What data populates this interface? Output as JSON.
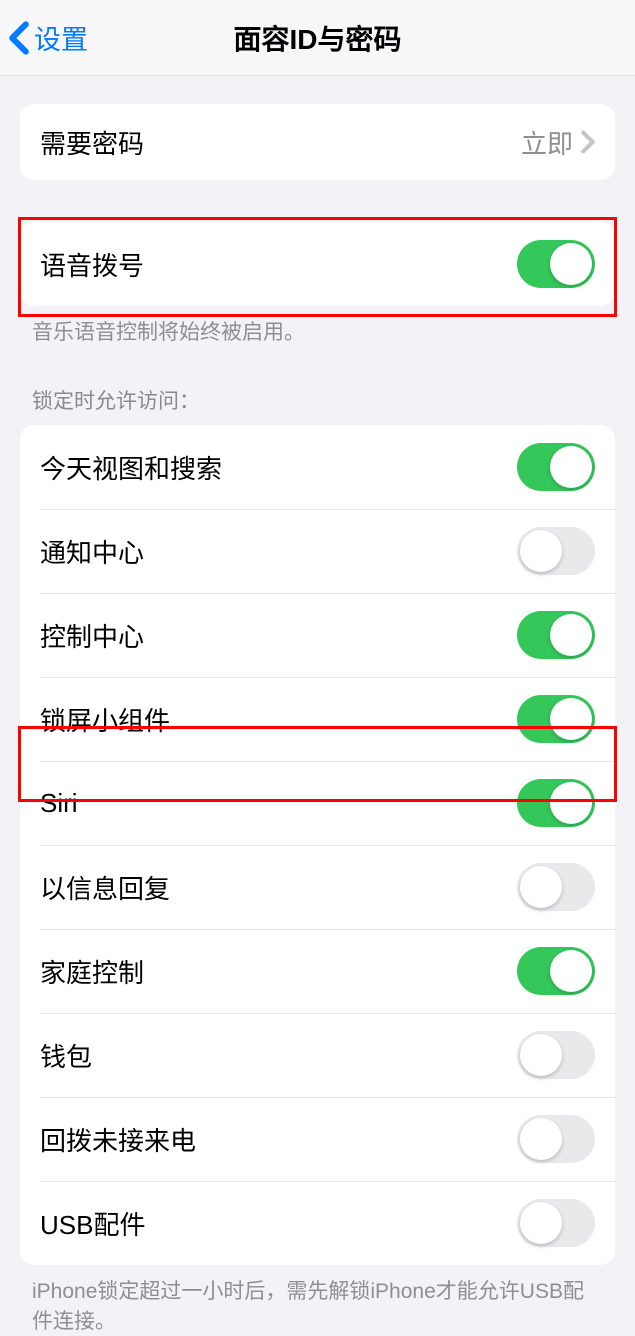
{
  "header": {
    "back_label": "设置",
    "title": "面容ID与密码"
  },
  "section1": {
    "require_passcode": {
      "label": "需要密码",
      "value": "立即"
    }
  },
  "section2": {
    "voice_dial": {
      "label": "语音拨号",
      "on": true
    },
    "footer": "音乐语音控制将始终被启用。"
  },
  "section3": {
    "header": "锁定时允许访问：",
    "items": [
      {
        "label": "今天视图和搜索",
        "on": true
      },
      {
        "label": "通知中心",
        "on": false
      },
      {
        "label": "控制中心",
        "on": true
      },
      {
        "label": "锁屏小组件",
        "on": true
      },
      {
        "label": "Siri",
        "on": true
      },
      {
        "label": "以信息回复",
        "on": false
      },
      {
        "label": "家庭控制",
        "on": true
      },
      {
        "label": "钱包",
        "on": false
      },
      {
        "label": "回拨未接来电",
        "on": false
      },
      {
        "label": "USB配件",
        "on": false
      }
    ],
    "footer": "iPhone锁定超过一小时后，需先解锁iPhone才能允许USB配件连接。"
  }
}
